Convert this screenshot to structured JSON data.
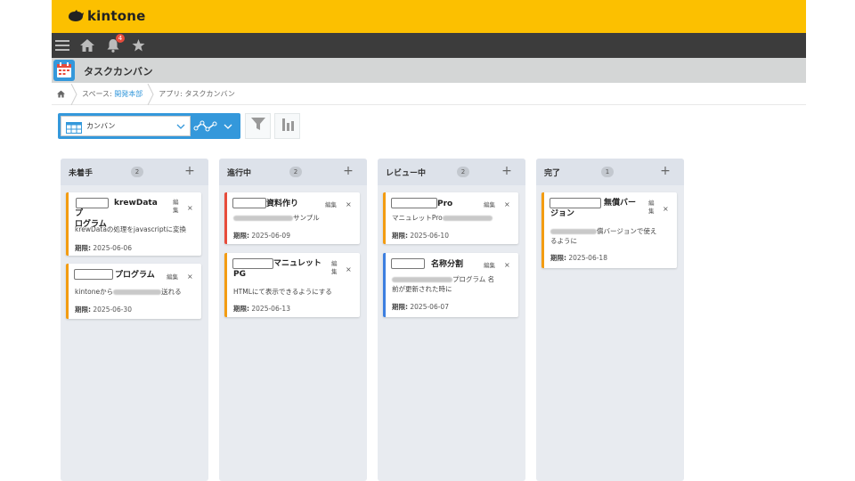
{
  "header": {
    "logo_text": "kintone",
    "brand_color": "#fcc000"
  },
  "nav": {
    "notification_count": "4",
    "icons": [
      "menu-icon",
      "home-icon",
      "bell-icon",
      "star-icon"
    ]
  },
  "app": {
    "title": "タスクカンバン"
  },
  "breadcrumb": {
    "space_prefix": "スペース: ",
    "space_name": "開発本部",
    "app_prefix": "アプリ: ",
    "app_name": "タスクカンバン"
  },
  "toolbar": {
    "view_label": "カンバン"
  },
  "columns": [
    {
      "title": "未着手",
      "count": "2",
      "add": "+",
      "cards": [
        {
          "title": "krewDataプ\nログラム",
          "edit": "編集",
          "close": "×",
          "desc": "krewDataの処理をjavascriptに変換",
          "due_label": "期限:",
          "due": "2025-06-06",
          "color": "#f39c12"
        },
        {
          "title": "プログラム",
          "edit": "編集",
          "close": "×",
          "desc_prefix": "kintoneから",
          "desc_suffix": "送れる",
          "due_label": "期限:",
          "due": "2025-06-30",
          "color": "#f39c12"
        }
      ]
    },
    {
      "title": "進行中",
      "count": "2",
      "add": "+",
      "cards": [
        {
          "title": "資料作り",
          "edit": "編集",
          "close": "×",
          "desc_suffix": "サンプル",
          "due_label": "期限:",
          "due": "2025-06-09",
          "color": "#e74c3c"
        },
        {
          "title": "マニュレット\nPG",
          "edit": "編集",
          "close": "×",
          "desc": "HTMLにて表示できるようにする",
          "due_label": "期限:",
          "due": "2025-06-13",
          "color": "#f39c12"
        }
      ]
    },
    {
      "title": "レビュー中",
      "count": "2",
      "add": "+",
      "cards": [
        {
          "title": "Pro",
          "edit": "編集",
          "close": "×",
          "desc_prefix": "マニュレットPro",
          "due_label": "期限:",
          "due": "2025-06-10",
          "color": "#f39c12"
        },
        {
          "title": "名称分割",
          "edit": "編集",
          "close": "×",
          "desc_suffix": "プログラム 名",
          "desc_line2": "前が更新された時に",
          "due_label": "期限:",
          "due": "2025-06-07",
          "color": "#3d7fe0"
        }
      ]
    },
    {
      "title": "完了",
      "count": "1",
      "add": "+",
      "cards": [
        {
          "title": "無償バー\nジョン",
          "edit": "編集",
          "close": "×",
          "desc_suffix": "償バージョンで使え",
          "desc_line2": "るように",
          "due_label": "期限:",
          "due": "2025-06-18",
          "color": "#f39c12"
        }
      ]
    }
  ]
}
